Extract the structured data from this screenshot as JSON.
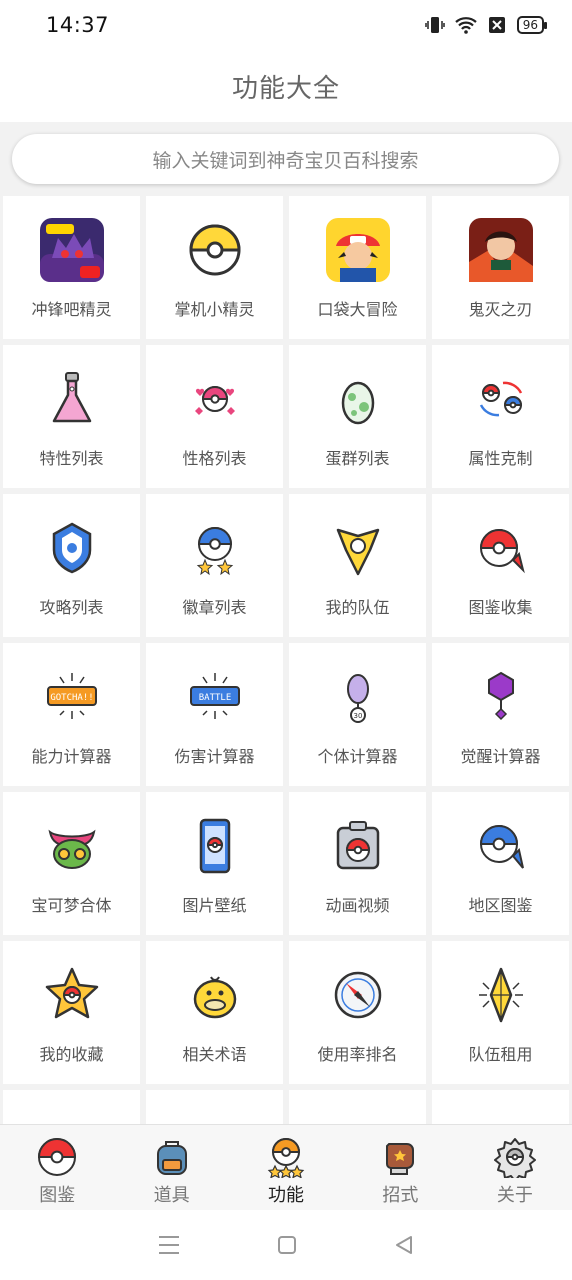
{
  "status": {
    "time": "14:37",
    "battery": "96"
  },
  "header": {
    "title": "功能大全"
  },
  "search": {
    "placeholder": "输入关键词到神奇宝贝百科搜索"
  },
  "grid": [
    {
      "label": "冲锋吧精灵",
      "icon": "gengar-app-icon"
    },
    {
      "label": "掌机小精灵",
      "icon": "yellow-pokeball-icon"
    },
    {
      "label": "口袋大冒险",
      "icon": "ash-app-icon"
    },
    {
      "label": "鬼灭之刃",
      "icon": "demon-slayer-app-icon"
    },
    {
      "label": "特性列表",
      "icon": "flask-icon"
    },
    {
      "label": "性格列表",
      "icon": "hearts-pokeball-icon"
    },
    {
      "label": "蛋群列表",
      "icon": "egg-icon"
    },
    {
      "label": "属性克制",
      "icon": "cycle-pokeball-icon"
    },
    {
      "label": "攻略列表",
      "icon": "shield-icon"
    },
    {
      "label": "徽章列表",
      "icon": "badge-stars-icon"
    },
    {
      "label": "我的队伍",
      "icon": "team-emblem-icon"
    },
    {
      "label": "图鉴收集",
      "icon": "pokeball-pin-icon"
    },
    {
      "label": "能力计算器",
      "icon": "gotcha-icon"
    },
    {
      "label": "伤害计算器",
      "icon": "battle-icon"
    },
    {
      "label": "个体计算器",
      "icon": "egg-30-icon"
    },
    {
      "label": "觉醒计算器",
      "icon": "crystal-icon"
    },
    {
      "label": "宝可梦合体",
      "icon": "mask-icon"
    },
    {
      "label": "图片壁纸",
      "icon": "phone-icon"
    },
    {
      "label": "动画视频",
      "icon": "camera-icon"
    },
    {
      "label": "地区图鉴",
      "icon": "map-pin-icon"
    },
    {
      "label": "我的收藏",
      "icon": "star-icon"
    },
    {
      "label": "相关术语",
      "icon": "psyduck-icon"
    },
    {
      "label": "使用率排名",
      "icon": "compass-icon"
    },
    {
      "label": "队伍租用",
      "icon": "diamond-icon"
    }
  ],
  "tabs": [
    {
      "label": "图鉴",
      "icon": "pokeball-icon"
    },
    {
      "label": "道具",
      "icon": "backpack-icon"
    },
    {
      "label": "功能",
      "icon": "function-icon"
    },
    {
      "label": "招式",
      "icon": "boxing-glove-icon"
    },
    {
      "label": "关于",
      "icon": "gear-icon"
    }
  ]
}
